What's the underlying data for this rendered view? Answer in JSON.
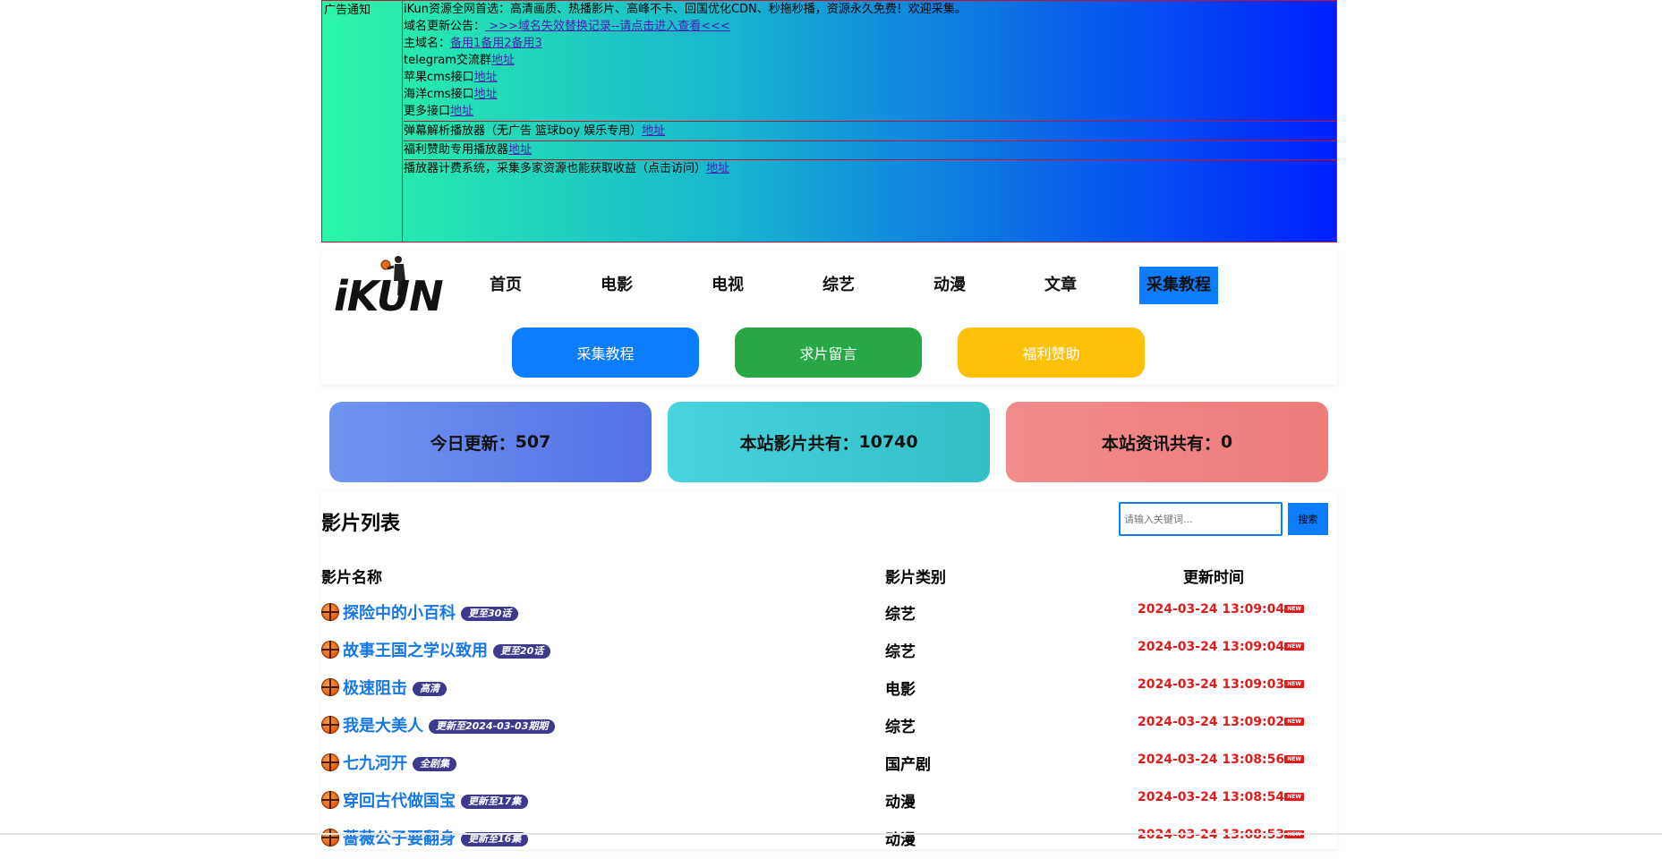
{
  "notice": {
    "label": "广告通知",
    "lines": [
      {
        "text": "iKun资源全网首选：高清画质、热播影片、高峰不卡、回国优化CDN、秒拖秒播，资源永久免费！欢迎采集。",
        "link": ""
      },
      {
        "text": "域名更新公告：",
        "link": " >>>域名失效替换记录--请点击进入查看<<<"
      },
      {
        "text": "主域名：",
        "link": "备用1备用2备用3"
      },
      {
        "text": "telegram交流群",
        "link": "地址"
      },
      {
        "text": "苹果cms接口",
        "link": "地址"
      },
      {
        "text": "海洋cms接口",
        "link": "地址"
      },
      {
        "text": "更多接口",
        "link": "地址"
      }
    ],
    "row2": {
      "text": "弹幕解析播放器（无广告 篮球boy 娱乐专用）",
      "link": "地址"
    },
    "row3": {
      "text": "福利赞助专用播放器",
      "link": "地址"
    },
    "row4": {
      "text": "播放器计费系统，采集多家资源也能获取收益（点击访问）",
      "link": "地址"
    }
  },
  "logo": {
    "text": "iKUN",
    "icon": "basketball-player-icon"
  },
  "nav": [
    "首页",
    "电影",
    "电视",
    "综艺",
    "动漫",
    "文章",
    "采集教程"
  ],
  "nav_active": "采集教程",
  "buttons": [
    {
      "label": "采集教程",
      "color": "#0d7dff"
    },
    {
      "label": "求片留言",
      "color": "#28a745"
    },
    {
      "label": "福利赞助",
      "color": "#ffc107"
    }
  ],
  "stats": [
    {
      "label": "今日更新：",
      "value": "507"
    },
    {
      "label": "本站影片共有：",
      "value": "10740"
    },
    {
      "label": "本站资讯共有：",
      "value": "0"
    }
  ],
  "list": {
    "title": "影片列表",
    "search_placeholder": "请输入关键词...",
    "search_button": "搜索",
    "columns": [
      "影片名称",
      "影片类别",
      "更新时间"
    ],
    "new_label": "NEW",
    "rows": [
      {
        "name": "探险中的小百科",
        "badge": "更至30话",
        "category": "综艺",
        "time": "2024-03-24 13:09:04"
      },
      {
        "name": "故事王国之学以致用",
        "badge": "更至20话",
        "category": "综艺",
        "time": "2024-03-24 13:09:04"
      },
      {
        "name": "极速阻击",
        "badge": "高清",
        "category": "电影",
        "time": "2024-03-24 13:09:03"
      },
      {
        "name": "我是大美人",
        "badge": "更新至2024-03-03期期",
        "category": "综艺",
        "time": "2024-03-24 13:09:02"
      },
      {
        "name": "七九河开",
        "badge": "全剧集",
        "category": "国产剧",
        "time": "2024-03-24 13:08:56"
      },
      {
        "name": "穿回古代做国宝",
        "badge": "更新至17集",
        "category": "动漫",
        "time": "2024-03-24 13:08:54"
      },
      {
        "name": "蔷薇公子要翻身",
        "badge": "更新至16集",
        "category": "动漫",
        "time": "2024-03-24 13:08:53"
      }
    ]
  }
}
